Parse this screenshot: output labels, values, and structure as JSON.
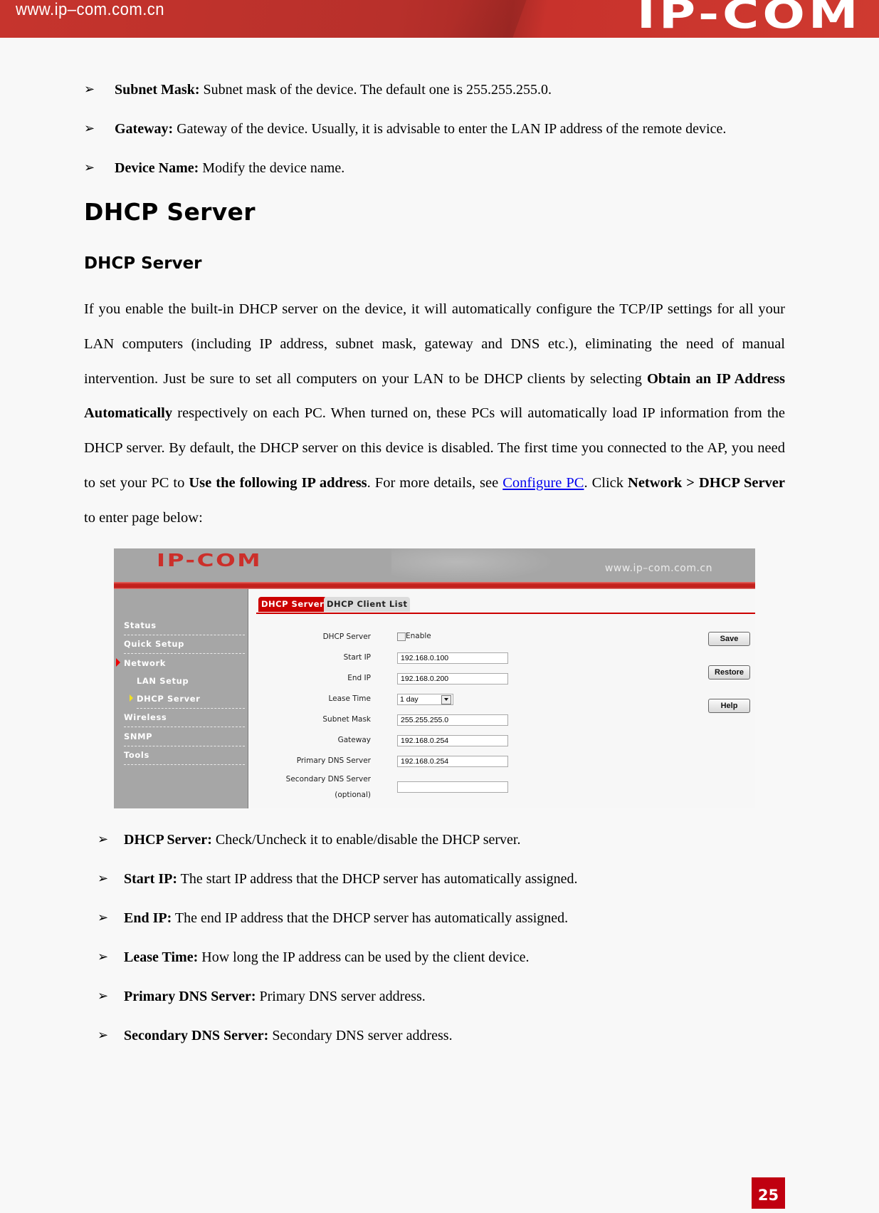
{
  "header": {
    "url": "www.ip–com.com.cn",
    "logo": "IP-COM",
    "brand_color": "#c6342d"
  },
  "top_bullets": [
    {
      "term": "Subnet Mask:",
      "desc": " Subnet mask of the device. The default one is 255.255.255.0."
    },
    {
      "term": "Gateway:",
      "desc": " Gateway of the device. Usually, it is advisable to enter the LAN IP address of the remote device."
    },
    {
      "term": "Device Name:",
      "desc": " Modify the device name."
    }
  ],
  "bullet_symbol": "➢",
  "heading1": "DHCP Server",
  "heading2": "DHCP Server",
  "paragraph": {
    "p1": "If you enable the built-in DHCP server on the device, it will automatically configure the TCP/IP settings for all your LAN computers (including IP address, subnet mask, gateway and DNS etc.), eliminating the need of manual intervention. Just be sure to set all computers on your LAN to be DHCP clients by selecting ",
    "b1": "Obtain an IP Address Automatically",
    "p2": " respectively on each PC. When turned on, these PCs will automatically load IP information from the DHCP server. By default, the DHCP server on this device is disabled. The first time you connected to the AP, you need to set your PC to ",
    "b2": "Use the following IP address",
    "p3": ". For more details, see ",
    "link": "Configure PC",
    "p4": ". Click ",
    "b3": "Network > DHCP Server",
    "p5": " to enter page below:"
  },
  "screenshot": {
    "logo": "IP-COM",
    "url": "www.ip–com.com.cn",
    "sidebar": [
      {
        "label": "Status"
      },
      {
        "label": "Quick Setup"
      },
      {
        "label": "Network"
      },
      {
        "label": "LAN Setup"
      },
      {
        "label": "DHCP Server"
      },
      {
        "label": "Wireless"
      },
      {
        "label": "SNMP"
      },
      {
        "label": "Tools"
      }
    ],
    "tabs": [
      {
        "label": "DHCP Server",
        "active": true
      },
      {
        "label": "DHCP Client List",
        "active": false
      }
    ],
    "form": {
      "dhcp_server_label": "DHCP Server",
      "enable_label": "Enable",
      "enable_checked": false,
      "start_ip_label": "Start IP",
      "start_ip_value": "192.168.0.100",
      "end_ip_label": "End IP",
      "end_ip_value": "192.168.0.200",
      "lease_time_label": "Lease Time",
      "lease_time_value": "1 day",
      "subnet_mask_label": "Subnet Mask",
      "subnet_mask_value": "255.255.255.0",
      "gateway_label": "Gateway",
      "gateway_value": "192.168.0.254",
      "primary_dns_label": "Primary DNS Server",
      "primary_dns_value": "192.168.0.254",
      "secondary_dns_label": "Secondary DNS Server",
      "secondary_dns_optional": "(optional)",
      "secondary_dns_value": ""
    },
    "buttons": {
      "save": "Save",
      "restore": "Restore",
      "help": "Help"
    }
  },
  "bottom_bullets": [
    {
      "term": "DHCP Server:",
      "desc": " Check/Uncheck it to enable/disable the DHCP server."
    },
    {
      "term": "Start IP:",
      "desc": " The start IP address that the DHCP server has automatically assigned."
    },
    {
      "term": "End IP:",
      "desc": " The end IP address that the DHCP server has automatically assigned."
    },
    {
      "term": "Lease Time:",
      "desc": " How long the IP address can be used by the client device."
    },
    {
      "term": "Primary DNS Server:",
      "desc": " Primary DNS server address."
    },
    {
      "term": "Secondary DNS Server:",
      "desc": " Secondary DNS server address."
    }
  ],
  "page_number": "25"
}
